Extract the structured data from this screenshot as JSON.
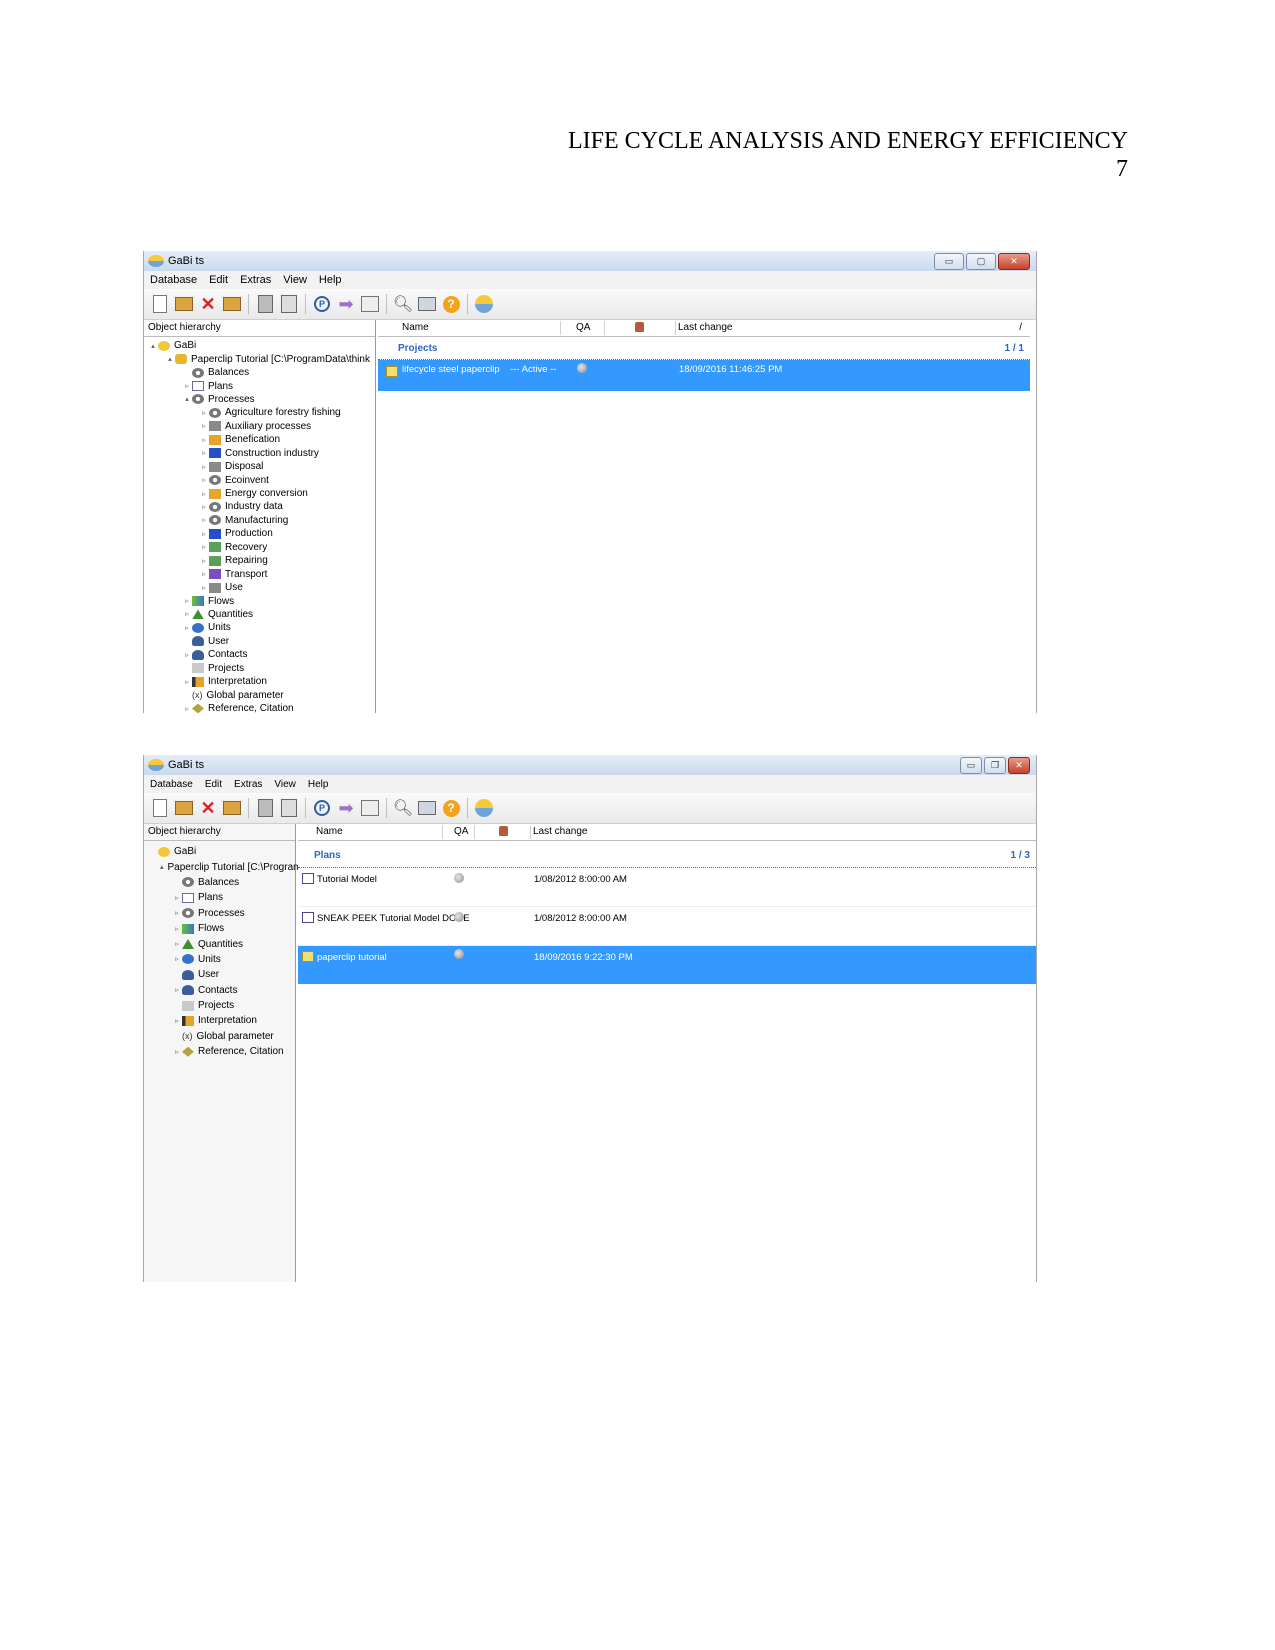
{
  "page": {
    "header_title": "LIFE CYCLE ANALYSIS AND ENERGY EFFICIENCY",
    "page_number": "7"
  },
  "window1": {
    "title": "GaBi ts",
    "menu": [
      "Database",
      "Edit",
      "Extras",
      "View",
      "Help"
    ],
    "left_header": "Object hierarchy",
    "tree": [
      {
        "label": "GaBi",
        "icon": "gabi-icon",
        "toggle": "▴",
        "level": 0
      },
      {
        "label": "Paperclip Tutorial [C:\\ProgramData\\think",
        "icon": "database-icon",
        "toggle": "▴",
        "level": 1
      },
      {
        "label": "Balances",
        "icon": "balances-icon",
        "toggle": "",
        "level": 2
      },
      {
        "label": "Plans",
        "icon": "plans-icon",
        "toggle": "▹",
        "level": 2
      },
      {
        "label": "Processes",
        "icon": "processes-icon",
        "toggle": "▴",
        "level": 2
      },
      {
        "label": "Agriculture forestry fishing",
        "icon": "gear-icon",
        "toggle": "▹",
        "level": 3
      },
      {
        "label": "Auxiliary processes",
        "icon": "gray-process-icon",
        "toggle": "▹",
        "level": 3
      },
      {
        "label": "Benefication",
        "icon": "orange-process-icon",
        "toggle": "▹",
        "level": 3
      },
      {
        "label": "Construction industry",
        "icon": "blue-process-icon",
        "toggle": "▹",
        "level": 3
      },
      {
        "label": "Disposal",
        "icon": "gray-process-icon",
        "toggle": "▹",
        "level": 3
      },
      {
        "label": "Ecoinvent",
        "icon": "gear-icon",
        "toggle": "▹",
        "level": 3
      },
      {
        "label": "Energy conversion",
        "icon": "orange-process-icon",
        "toggle": "▹",
        "level": 3
      },
      {
        "label": "Industry data",
        "icon": "gear-icon",
        "toggle": "▹",
        "level": 3
      },
      {
        "label": "Manufacturing",
        "icon": "gear-icon",
        "toggle": "▹",
        "level": 3
      },
      {
        "label": "Production",
        "icon": "blue-process-icon",
        "toggle": "▹",
        "level": 3
      },
      {
        "label": "Recovery",
        "icon": "green-process-icon",
        "toggle": "▹",
        "level": 3
      },
      {
        "label": "Repairing",
        "icon": "green-process-icon",
        "toggle": "▹",
        "level": 3
      },
      {
        "label": "Transport",
        "icon": "purple-process-icon",
        "toggle": "▹",
        "level": 3
      },
      {
        "label": "Use",
        "icon": "gray-process-icon",
        "toggle": "▹",
        "level": 3
      },
      {
        "label": "Flows",
        "icon": "flows-icon",
        "toggle": "▹",
        "level": 2
      },
      {
        "label": "Quantities",
        "icon": "quantities-icon",
        "toggle": "▹",
        "level": 2
      },
      {
        "label": "Units",
        "icon": "units-icon",
        "toggle": "▹",
        "level": 2
      },
      {
        "label": "User",
        "icon": "user-icon",
        "toggle": "",
        "level": 2
      },
      {
        "label": "Contacts",
        "icon": "contacts-icon",
        "toggle": "▹",
        "level": 2
      },
      {
        "label": "Projects",
        "icon": "projects-icon",
        "toggle": "",
        "level": 2
      },
      {
        "label": "Interpretation",
        "icon": "interpretation-icon",
        "toggle": "▹",
        "level": 2
      },
      {
        "label": "Global parameter",
        "icon": "parameter-icon",
        "toggle": "",
        "level": 2
      },
      {
        "label": "Reference, Citation",
        "icon": "reference-icon",
        "toggle": "▹",
        "level": 2
      }
    ],
    "columns": {
      "name": "Name",
      "qa": "QA",
      "last_change": "Last change",
      "sort": "/"
    },
    "group": {
      "title": "Projects",
      "count": "1 / 1"
    },
    "rows": [
      {
        "name": "lifecycle steel paperclip",
        "status": "--- Active --",
        "last_change": "18/09/2016 11:46:25 PM",
        "selected": true
      }
    ]
  },
  "window2": {
    "title": "GaBi ts",
    "menu": [
      "Database",
      "Edit",
      "Extras",
      "View",
      "Help"
    ],
    "left_header": "Object hierarchy",
    "tree": [
      {
        "label": "GaBi",
        "icon": "gabi-icon",
        "toggle": "",
        "level": 0
      },
      {
        "label": "Paperclip Tutorial [C:\\ProgramData\\",
        "icon": "database-icon",
        "toggle": "▴",
        "level": 1
      },
      {
        "label": "Balances",
        "icon": "balances-icon",
        "toggle": "",
        "level": 2
      },
      {
        "label": "Plans",
        "icon": "plans-icon",
        "toggle": "▹",
        "level": 2
      },
      {
        "label": "Processes",
        "icon": "processes-icon",
        "toggle": "▹",
        "level": 2
      },
      {
        "label": "Flows",
        "icon": "flows-icon",
        "toggle": "▹",
        "level": 2
      },
      {
        "label": "Quantities",
        "icon": "quantities-icon",
        "toggle": "▹",
        "level": 2
      },
      {
        "label": "Units",
        "icon": "units-icon",
        "toggle": "▹",
        "level": 2
      },
      {
        "label": "User",
        "icon": "user-icon",
        "toggle": "",
        "level": 2
      },
      {
        "label": "Contacts",
        "icon": "contacts-icon",
        "toggle": "▹",
        "level": 2
      },
      {
        "label": "Projects",
        "icon": "projects-icon",
        "toggle": "",
        "level": 2
      },
      {
        "label": "Interpretation",
        "icon": "interpretation-icon",
        "toggle": "▹",
        "level": 2
      },
      {
        "label": "Global parameter",
        "icon": "parameter-icon",
        "toggle": "",
        "level": 2
      },
      {
        "label": "Reference, Citation",
        "icon": "reference-icon",
        "toggle": "▹",
        "level": 2
      }
    ],
    "columns": {
      "name": "Name",
      "qa": "QA",
      "last_change": "Last change"
    },
    "group": {
      "title": "Plans",
      "count": "1 / 3"
    },
    "rows": [
      {
        "name": "Tutorial Model",
        "last_change": "1/08/2012 8:00:00 AM",
        "selected": false
      },
      {
        "name": "SNEAK PEEK Tutorial Model DONE",
        "last_change": "1/08/2012 8:00:00 AM",
        "selected": false
      },
      {
        "name": "paperclip tutorial",
        "last_change": "18/09/2016 9:22:30 PM",
        "selected": true
      }
    ]
  },
  "colors": {
    "selection": "#3399ff",
    "group_title": "#2a66c4",
    "titlebar": "#c9d9ee"
  },
  "toolbar_icons": [
    "new-icon",
    "open-icon",
    "delete-icon",
    "copy-icon",
    "paste-icon",
    "p-icon",
    "arrow-icon",
    "chart-icon",
    "search-icon",
    "window-icon",
    "help-icon",
    "gabi-icon"
  ]
}
